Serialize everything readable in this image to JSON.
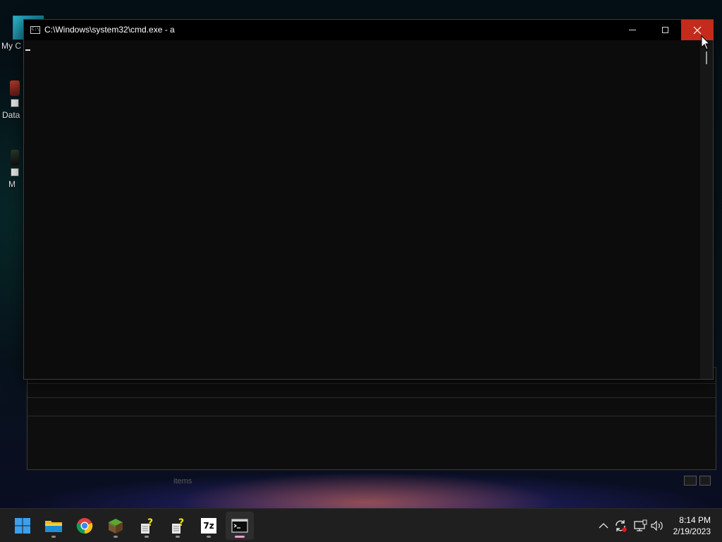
{
  "desktop": {
    "icons": [
      {
        "label": "My C"
      },
      {
        "label": "Data"
      },
      {
        "label": "M"
      }
    ],
    "background_window": {
      "status_text": "items"
    }
  },
  "cmd_window": {
    "title": "C:\\Windows\\system32\\cmd.exe - a",
    "icon_text": "C:\\",
    "minimize_icon": "minimize-icon",
    "maximize_icon": "maximize-icon",
    "close_icon": "close-icon",
    "close_hover_color": "#c42b1c"
  },
  "taskbar": {
    "apps": [
      {
        "name": "start-button",
        "icon": "windows-logo-icon"
      },
      {
        "name": "file-explorer",
        "icon": "folder-icon"
      },
      {
        "name": "chrome",
        "icon": "chrome-icon"
      },
      {
        "name": "minecraft",
        "icon": "grass-block-icon"
      },
      {
        "name": "unknown-app-1",
        "icon": "question-mark-icon"
      },
      {
        "name": "unknown-app-2",
        "icon": "question-mark-icon"
      },
      {
        "name": "7zip",
        "icon": "7zip-icon",
        "text": "7z"
      },
      {
        "name": "command-prompt",
        "icon": "terminal-icon",
        "active": true
      }
    ],
    "tray": {
      "chevron": "chevron-up-icon",
      "sync": "sync-icon",
      "network": "network-icon",
      "volume": "volume-icon"
    },
    "clock": {
      "time": "8:14 PM",
      "date": "2/19/2023"
    }
  }
}
